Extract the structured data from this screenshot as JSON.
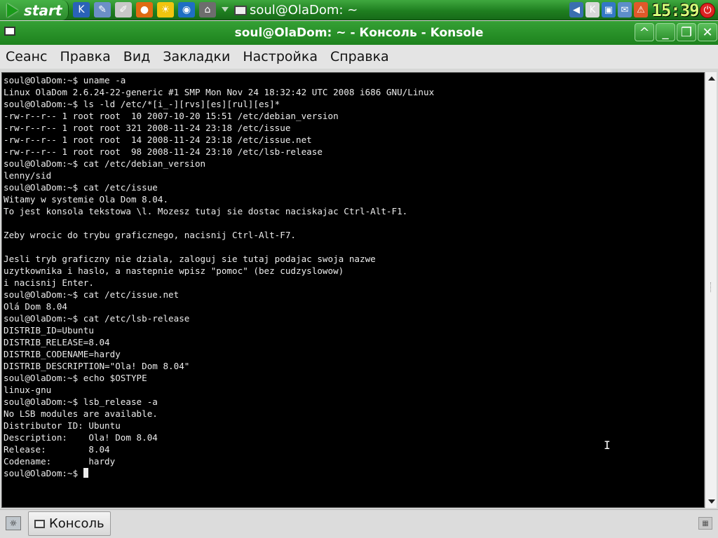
{
  "panel": {
    "start_label": "start",
    "launchers": [
      {
        "icon": "kde-k-icon",
        "glyph": "K",
        "color": "#2a62b8"
      },
      {
        "icon": "text-editor-icon",
        "glyph": "✎",
        "color": "#6c8fc7"
      },
      {
        "icon": "notes-icon",
        "glyph": "✐",
        "color": "#c8c8c8"
      },
      {
        "icon": "firefox-icon",
        "glyph": "●",
        "color": "#e06b12"
      },
      {
        "icon": "sun-icon",
        "glyph": "☀",
        "color": "#f1c40f"
      },
      {
        "icon": "browser-icon",
        "glyph": "◉",
        "color": "#1f6fc4"
      },
      {
        "icon": "screenshot-icon",
        "glyph": "⌂",
        "color": "#6d6d6d"
      }
    ],
    "task_title": "soul@OlaDom: ~",
    "tray_icons": [
      {
        "icon": "volume-icon",
        "glyph": "◀",
        "color": "#3a6fb0"
      },
      {
        "icon": "klipper-icon",
        "glyph": "K",
        "color": "#d8d8d8"
      },
      {
        "icon": "network-icon",
        "glyph": "▣",
        "color": "#3478c6"
      },
      {
        "icon": "update-icon",
        "glyph": "✉",
        "color": "#5d8ec9"
      },
      {
        "icon": "warning-icon",
        "glyph": "⚠",
        "color": "#e0592a"
      }
    ],
    "clock": "15:39"
  },
  "window": {
    "title": "soul@OlaDom: ~ - Консоль - Konsole"
  },
  "menu": [
    "Сеанс",
    "Правка",
    "Вид",
    "Закладки",
    "Настройка",
    "Справка"
  ],
  "terminal": {
    "lines": [
      "soul@OlaDom:~$ uname -a",
      "Linux OlaDom 2.6.24-22-generic #1 SMP Mon Nov 24 18:32:42 UTC 2008 i686 GNU/Linux",
      "soul@OlaDom:~$ ls -ld /etc/*[i_-][rvs][es][rul][es]*",
      "-rw-r--r-- 1 root root  10 2007-10-20 15:51 /etc/debian_version",
      "-rw-r--r-- 1 root root 321 2008-11-24 23:18 /etc/issue",
      "-rw-r--r-- 1 root root  14 2008-11-24 23:18 /etc/issue.net",
      "-rw-r--r-- 1 root root  98 2008-11-24 23:10 /etc/lsb-release",
      "soul@OlaDom:~$ cat /etc/debian_version",
      "lenny/sid",
      "soul@OlaDom:~$ cat /etc/issue",
      "Witamy w systemie Ola Dom 8.04.",
      "To jest konsola tekstowa \\l. Mozesz tutaj sie dostac naciskajac Ctrl-Alt-F1.",
      "",
      "Zeby wrocic do trybu graficznego, nacisnij Ctrl-Alt-F7.",
      "",
      "Jesli tryb graficzny nie dziala, zaloguj sie tutaj podajac swoja nazwe",
      "uzytkownika i haslo, a nastepnie wpisz \"pomoc\" (bez cudzyslowow)",
      "i nacisnij Enter.",
      "soul@OlaDom:~$ cat /etc/issue.net",
      "Olá Dom 8.04",
      "soul@OlaDom:~$ cat /etc/lsb-release",
      "DISTRIB_ID=Ubuntu",
      "DISTRIB_RELEASE=8.04",
      "DISTRIB_CODENAME=hardy",
      "DISTRIB_DESCRIPTION=\"Ola! Dom 8.04\"",
      "soul@OlaDom:~$ echo $OSTYPE",
      "linux-gnu",
      "soul@OlaDom:~$ lsb_release -a",
      "No LSB modules are available.",
      "Distributor ID: Ubuntu",
      "Description:    Ola! Dom 8.04",
      "Release:        8.04",
      "Codename:       hardy"
    ],
    "prompt": "soul@OlaDom:~$ "
  },
  "taskbar": {
    "task_label": "Консоль"
  },
  "colors": {
    "panel_green": "#1f7f20",
    "terminal_bg": "#000000",
    "terminal_fg": "#ececec"
  }
}
